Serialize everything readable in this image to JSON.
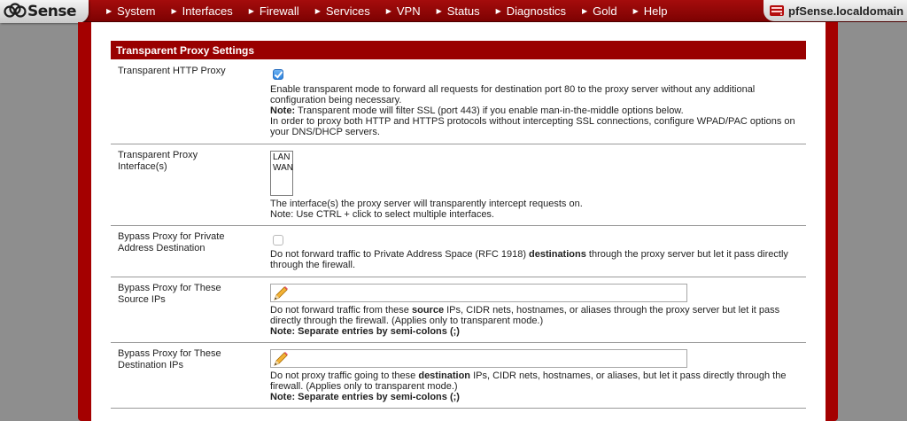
{
  "header": {
    "logo_text": "Sense",
    "hostname": "pfSense.localdomain",
    "nav": [
      "System",
      "Interfaces",
      "Firewall",
      "Services",
      "VPN",
      "Status",
      "Diagnostics",
      "Gold",
      "Help"
    ]
  },
  "section": {
    "title": "Transparent Proxy Settings"
  },
  "rows": {
    "transparent_http": {
      "label": "Transparent HTTP Proxy",
      "checked": true,
      "desc1": "Enable transparent mode to forward all requests for destination port 80 to the proxy server without any additional",
      "desc2": "configuration being necessary.",
      "note_label": "Note:",
      "note_text": " Transparent mode will filter SSL (port 443) if you enable man-in-the-middle options below.",
      "desc3": "In order to proxy both HTTP and HTTPS protocols without intercepting SSL connections, configure WPAD/PAC options on",
      "desc4": "your DNS/DHCP servers."
    },
    "interfaces": {
      "label1": "Transparent Proxy",
      "label2": "Interface(s)",
      "options": [
        "LAN",
        "WAN"
      ],
      "desc1": "The interface(s) the proxy server will transparently intercept requests on.",
      "desc2": "Note: Use CTRL + click to select multiple interfaces."
    },
    "bypass_private": {
      "label1": "Bypass Proxy for Private",
      "label2": "Address Destination",
      "checked": false,
      "desc1a": "Do not forward traffic to Private Address Space (RFC 1918) ",
      "desc1b": "destinations",
      "desc1c": " through the proxy server but let it pass directly",
      "desc2": "through the firewall."
    },
    "bypass_source": {
      "label1": "Bypass Proxy for These",
      "label2": "Source IPs",
      "value": "",
      "desc1a": "Do not forward traffic from these ",
      "desc1b": "source",
      "desc1c": " IPs, CIDR nets, hostnames, or aliases through the proxy server but let it pass",
      "desc2": "directly through the firewall. (Applies only to transparent mode.)",
      "note": "Note: Separate entries by semi-colons (;)"
    },
    "bypass_dest": {
      "label1": "Bypass Proxy for These",
      "label2": "Destination IPs",
      "value": "",
      "desc1a": "Do not proxy traffic going to these ",
      "desc1b": "destination",
      "desc1c": " IPs, CIDR nets, hostnames, or aliases, but let it pass directly through the",
      "desc2": "firewall. (Applies only to transparent mode.)",
      "note": "Note: Separate entries by semi-colons (;)"
    }
  }
}
